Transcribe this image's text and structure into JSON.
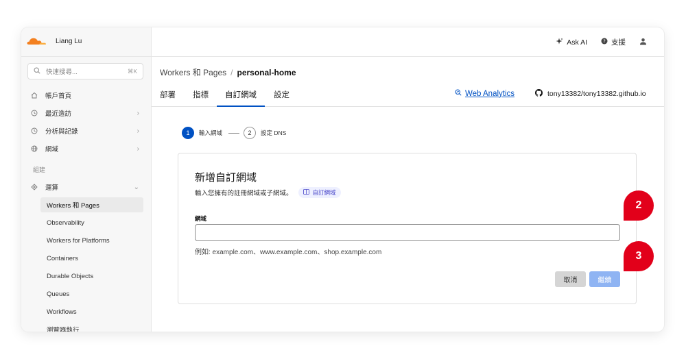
{
  "account": {
    "name": "Liang Lu"
  },
  "topbar": {
    "ask_ai": "Ask AI",
    "support": "支援"
  },
  "search": {
    "placeholder": "快速搜尋...",
    "shortcut": "⌘K"
  },
  "sidebar": {
    "items": [
      {
        "label": "帳戶首頁",
        "icon": "home-icon"
      },
      {
        "label": "最近造訪",
        "icon": "clock-icon"
      },
      {
        "label": "分析與記錄",
        "icon": "clock-icon"
      },
      {
        "label": "網域",
        "icon": "globe-icon"
      }
    ],
    "section_label": "組建",
    "compute": {
      "label": "運算",
      "icon": "compute-icon"
    },
    "sub_items": [
      "Workers 和 Pages",
      "Observability",
      "Workers for Platforms",
      "Containers",
      "Durable Objects",
      "Queues",
      "Workflows",
      "瀏覽器執行"
    ]
  },
  "breadcrumb": {
    "parent": "Workers 和 Pages",
    "separator": "/",
    "current": "personal-home"
  },
  "tabs": [
    "部署",
    "指標",
    "自訂網域",
    "設定"
  ],
  "web_analytics": "Web Analytics",
  "repo": "tony13382/tony13382.github.io",
  "stepper": {
    "step1": {
      "num": "1",
      "label": "輸入網域"
    },
    "step2": {
      "num": "2",
      "label": "設定 DNS"
    }
  },
  "card": {
    "title": "新增自訂網域",
    "subtitle": "輸入您擁有的註冊網域或子網域。",
    "pill": "自訂網域",
    "field_label": "網域",
    "field_value": "",
    "help": "例如: example.com、www.example.com、shop.example.com",
    "cancel": "取消",
    "continue": "繼續"
  },
  "callouts": [
    "2",
    "3"
  ],
  "colors": {
    "accent": "#0051c3",
    "callout": "#e2001a",
    "logo": "#f38020"
  }
}
